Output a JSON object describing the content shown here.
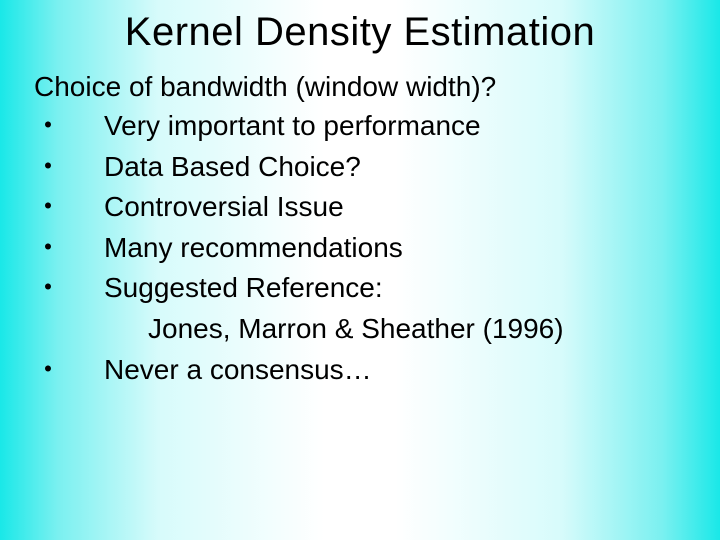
{
  "title": "Kernel Density Estimation",
  "lead": "Choice of bandwidth (window width)?",
  "dot": "・",
  "bullets": {
    "b0": "Very important to performance",
    "b1": "Data Based Choice?",
    "b2": "Controversial Issue",
    "b3": "Many recommendations",
    "b4": "Suggested Reference:",
    "b5": "Never a consensus…"
  },
  "sub": "Jones, Marron & Sheather (1996)"
}
